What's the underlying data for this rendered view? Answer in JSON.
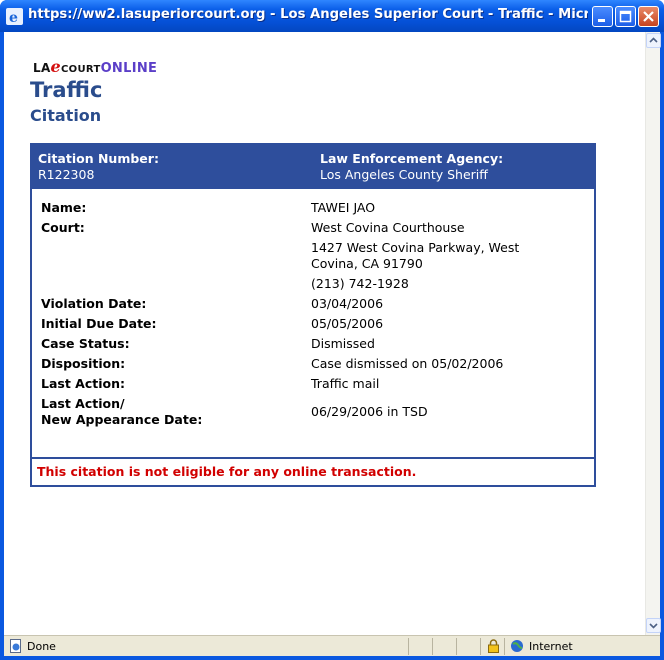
{
  "window": {
    "title": "https://ww2.lasuperiorcourt.org - Los Angeles Superior Court - Traffic - Microsoft Inter..."
  },
  "logo": {
    "la": "LA",
    "e": "e",
    "court": "COURT",
    "online": "ONLINE"
  },
  "page": {
    "title": "Traffic",
    "subtitle": "Citation"
  },
  "citation": {
    "number_label": "Citation Number:",
    "number": "R122308",
    "agency_label": "Law Enforcement Agency:",
    "agency": "Los Angeles County Sheriff"
  },
  "fields": {
    "name_label": "Name:",
    "name": "TAWEI JAO",
    "court_label": "Court:",
    "court_name": "West Covina Courthouse",
    "court_address_1": "1427 West Covina Parkway, West",
    "court_address_2": "Covina, CA 91790",
    "court_phone": "(213) 742-1928",
    "violation_date_label": "Violation Date:",
    "violation_date": "03/04/2006",
    "initial_due_date_label": "Initial Due Date:",
    "initial_due_date": "05/05/2006",
    "case_status_label": "Case Status:",
    "case_status": "Dismissed",
    "disposition_label": "Disposition:",
    "disposition": "Case dismissed on 05/02/2006",
    "last_action_label": "Last Action:",
    "last_action": "Traffic mail",
    "new_appearance_label_1": "Last Action/",
    "new_appearance_label_2": "New Appearance Date:",
    "new_appearance_date": "06/29/2006 in TSD"
  },
  "notice": "This citation is not eligible for any online transaction.",
  "statusbar": {
    "status": "Done",
    "zone": "Internet"
  },
  "colors": {
    "accent": "#2e4e9c",
    "title": "#2a4c8c",
    "notice": "#d10000"
  }
}
